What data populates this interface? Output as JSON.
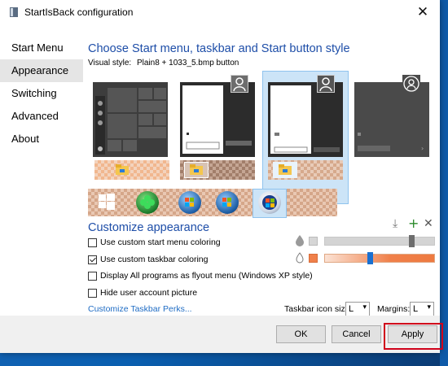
{
  "window": {
    "title": "StartIsBack configuration"
  },
  "nav": {
    "items": [
      {
        "label": "Start Menu"
      },
      {
        "label": "Appearance"
      },
      {
        "label": "Switching"
      },
      {
        "label": "Advanced"
      },
      {
        "label": "About"
      }
    ],
    "active_index": 1
  },
  "style_section": {
    "heading": "Choose Start menu, taskbar and Start button style",
    "visual_style_label": "Visual style:",
    "visual_style_value": "Plain8 + 1033_5.bmp button",
    "selected_menu_style_index": 2,
    "selected_taskbar_style_index": 2,
    "selected_button_style_index": 4
  },
  "customize": {
    "heading": "Customize appearance",
    "options": [
      {
        "label": "Use custom start menu coloring",
        "checked": false
      },
      {
        "label": "Use custom taskbar coloring",
        "checked": true
      },
      {
        "label": "Display All programs as flyout menu (Windows XP style)",
        "checked": false
      },
      {
        "label": "Hide user account picture",
        "checked": false
      }
    ],
    "start_menu_transparency": 0.8,
    "taskbar_transparency": 0.4,
    "taskbar_color": "#f0804a",
    "perks_link": "Customize Taskbar Perks...",
    "icon_size_label": "Taskbar icon size:",
    "icon_size_value": "L",
    "margins_label": "Margins:",
    "margins_value": "L"
  },
  "icons": [
    "download-icon",
    "add-icon",
    "remove-icon"
  ],
  "buttons": {
    "ok": "OK",
    "cancel": "Cancel",
    "apply": "Apply"
  },
  "colors": {
    "accent": "#1e4ea8",
    "link": "#1f6cc4",
    "highlight": "#d0021b",
    "selection": "#cce4f7"
  }
}
